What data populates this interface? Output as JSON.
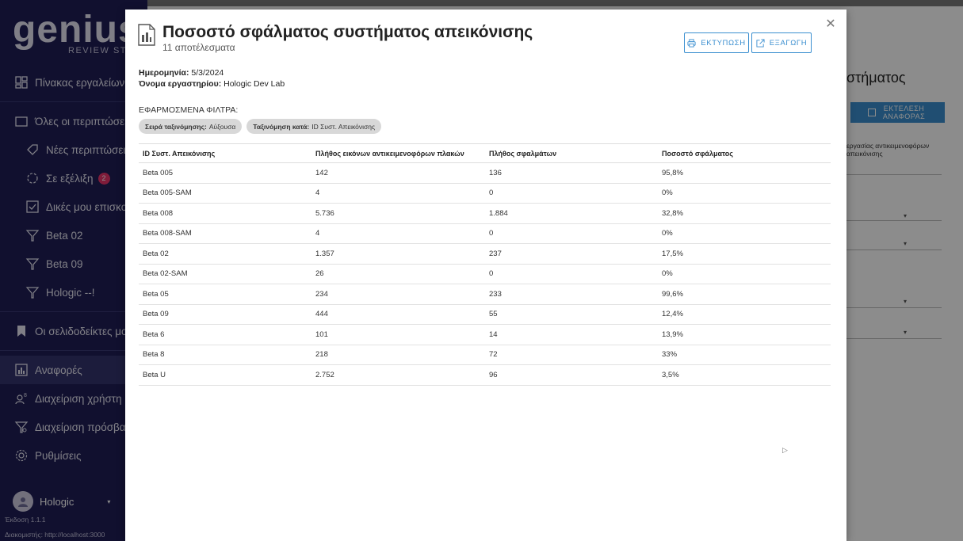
{
  "app": {
    "logo_text": "genius",
    "logo_subtitle": "REVIEW STATION"
  },
  "sidebar": {
    "items": [
      {
        "label": "Πίνακας εργαλείων",
        "icon": "dashboard-icon"
      },
      {
        "label": "Όλες οι περιπτώσεις",
        "icon": "folder-icon"
      },
      {
        "label": "Νέες περιπτώσεις",
        "icon": "tag-icon"
      },
      {
        "label": "Σε εξέλιξη",
        "icon": "progress-icon",
        "badge": "2"
      },
      {
        "label": "Δικές μου επισκοπήσεις",
        "icon": "checkbox-icon"
      },
      {
        "label": "Beta 02",
        "icon": "filter-icon"
      },
      {
        "label": "Beta 09",
        "icon": "filter-icon"
      },
      {
        "label": "Hologic --!",
        "icon": "filter-icon"
      },
      {
        "label": "Οι σελιδοδείκτες μου",
        "icon": "bookmark-icon"
      },
      {
        "label": "Αναφορές",
        "icon": "report-icon"
      },
      {
        "label": "Διαχείριση χρήστη",
        "icon": "users-icon"
      },
      {
        "label": "Διαχείριση πρόσβασης",
        "icon": "access-icon"
      },
      {
        "label": "Ρυθμίσεις",
        "icon": "gear-icon"
      }
    ],
    "user": "Hologic",
    "version": "Έκδοση 1.1.1",
    "server": "Διακομιστής: http://localhost:3000"
  },
  "background": {
    "title_partial": "στήματος",
    "run_button": "ΕΚΤΕΛΕΣΗ ΑΝΑΦΟΡΑΣ",
    "description_partial": "εργασίας αντικειμενοφόρων απεικόνισης"
  },
  "modal": {
    "title": "Ποσοστό σφάλματος συστήματος απεικόνισης",
    "subtitle": "11 αποτέλεσματα",
    "print_label": "ΕΚΤΥΠΩΣΗ",
    "export_label": "ΕΞΑΓΩΓΗ",
    "date_label": "Ημερομηνία:",
    "date_value": "5/3/2024",
    "lab_label": "Όνομα εργαστηρίου:",
    "lab_value": "Hologic Dev Lab",
    "filters_title": "ΕΦΑΡΜΟΣΜΕΝΑ ΦΙΛΤΡΑ:",
    "chips": [
      {
        "key": "Σειρά ταξινόμησης:",
        "value": "Αύξουσα"
      },
      {
        "key": "Ταξινόμηση κατά:",
        "value": "ID Συστ. Απεικόνισης"
      }
    ],
    "table": {
      "headers": [
        "ID Συστ. Απεικόνισης",
        "Πλήθος εικόνων αντικειμενοφόρων πλακών",
        "Πλήθος σφαλμάτων",
        "Ποσοστό σφάλματος"
      ],
      "rows": [
        [
          "Beta 005",
          "142",
          "136",
          "95,8%"
        ],
        [
          "Beta 005-SAM",
          "4",
          "0",
          "0%"
        ],
        [
          "Beta 008",
          "5.736",
          "1.884",
          "32,8%"
        ],
        [
          "Beta 008-SAM",
          "4",
          "0",
          "0%"
        ],
        [
          "Beta 02",
          "1.357",
          "237",
          "17,5%"
        ],
        [
          "Beta 02-SAM",
          "26",
          "0",
          "0%"
        ],
        [
          "Beta 05",
          "234",
          "233",
          "99,6%"
        ],
        [
          "Beta 09",
          "444",
          "55",
          "12,4%"
        ],
        [
          "Beta 6",
          "101",
          "14",
          "13,9%"
        ],
        [
          "Beta 8",
          "218",
          "72",
          "33%"
        ],
        [
          "Beta U",
          "2.752",
          "96",
          "3,5%"
        ]
      ]
    }
  },
  "colors": {
    "sidebar_bg": "#1f1e57",
    "accent": "#3b8fd0",
    "badge": "#e7336b"
  }
}
